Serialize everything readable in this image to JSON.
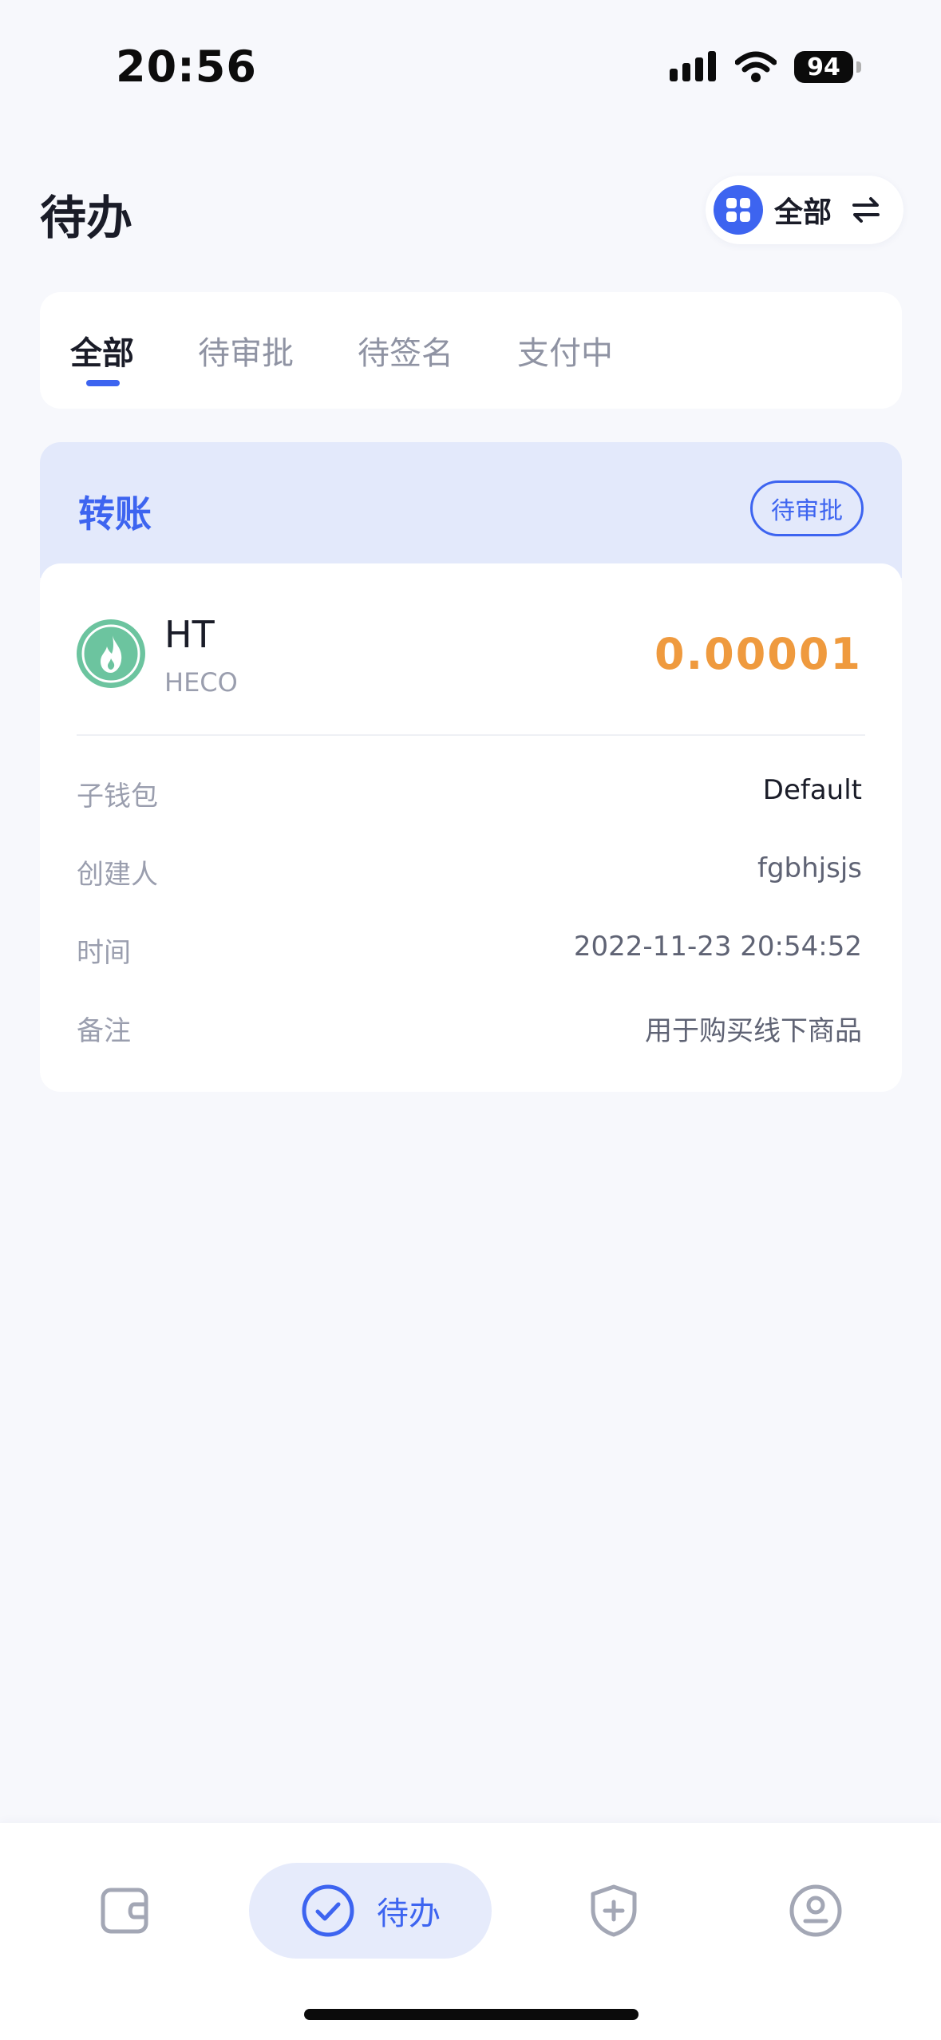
{
  "status_bar": {
    "time": "20:56",
    "battery": "94"
  },
  "header": {
    "title": "待办",
    "scope_label": "全部"
  },
  "tabs": [
    {
      "label": "全部"
    },
    {
      "label": "待审批"
    },
    {
      "label": "待签名"
    },
    {
      "label": "支付中"
    }
  ],
  "active_tab": "全部",
  "transaction": {
    "type": "转账",
    "status": "待审批",
    "token_symbol": "HT",
    "token_chain": "HECO",
    "amount": "0.00001",
    "details": [
      {
        "label": "子钱包",
        "value": "Default"
      },
      {
        "label": "创建人",
        "value": "fgbhjsjs"
      },
      {
        "label": "时间",
        "value": "2022-11-23 20:54:52"
      },
      {
        "label": "备注",
        "value": "用于购买线下商品"
      }
    ]
  },
  "bottom_nav": {
    "items": [
      {
        "icon": "wallet-icon"
      },
      {
        "icon": "check-circle-icon",
        "label": "待办"
      },
      {
        "icon": "shield-plus-icon"
      },
      {
        "icon": "profile-icon"
      }
    ]
  },
  "colors": {
    "accent": "#3d64f0",
    "amount": "#ef9a3e",
    "token": "#6cc49f"
  }
}
